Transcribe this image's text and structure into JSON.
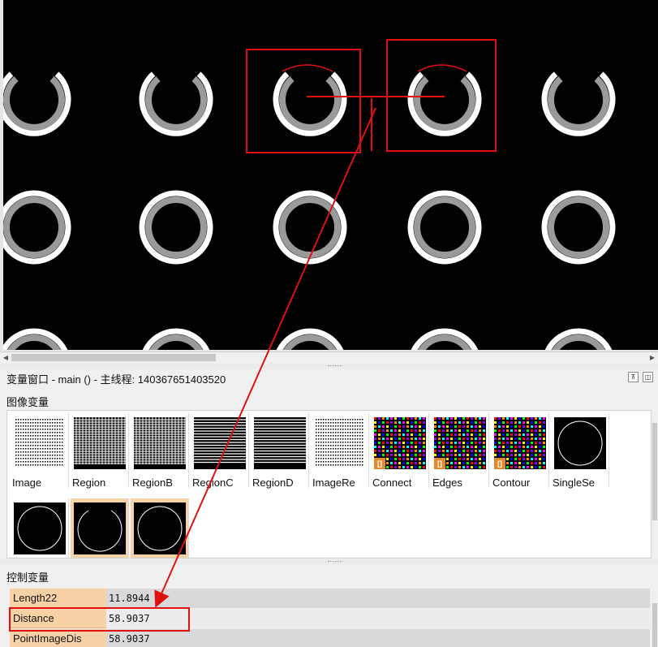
{
  "var_window": {
    "title": "变量窗口 - main () - 主线程: 140367651403520",
    "pin_icon": "pin-icon",
    "restore_icon": "restore-icon"
  },
  "image_vars": {
    "label": "图像变量",
    "items": [
      {
        "name": "Image",
        "kind": "dots"
      },
      {
        "name": "Region",
        "kind": "grid"
      },
      {
        "name": "RegionB",
        "kind": "grid"
      },
      {
        "name": "RegionC",
        "kind": "hlines"
      },
      {
        "name": "RegionD",
        "kind": "hlines"
      },
      {
        "name": "ImageRe",
        "kind": "dots"
      },
      {
        "name": "Connect",
        "kind": "color",
        "tuple": true
      },
      {
        "name": "Edges",
        "kind": "color",
        "tuple": true
      },
      {
        "name": "Contour",
        "kind": "color",
        "tuple": true
      },
      {
        "name": "SingleSe",
        "kind": "circle"
      },
      {
        "name": "",
        "kind": "circle"
      },
      {
        "name": "",
        "kind": "arc",
        "selected": true
      },
      {
        "name": "",
        "kind": "circle",
        "selected": true
      }
    ],
    "tuple_badge": "[]"
  },
  "control_vars": {
    "label": "控制变量",
    "rows": [
      {
        "name": "Length22",
        "value": "11.8944"
      },
      {
        "name": "Distance",
        "value": "58.9037"
      },
      {
        "name": "PointImageDis",
        "value": "58.9037"
      }
    ]
  },
  "colors": {
    "highlight": "#f8d1a6",
    "annotation": "#e01010",
    "ring_outer": "#ffffff",
    "ring_inner": "#9a9a9a"
  }
}
